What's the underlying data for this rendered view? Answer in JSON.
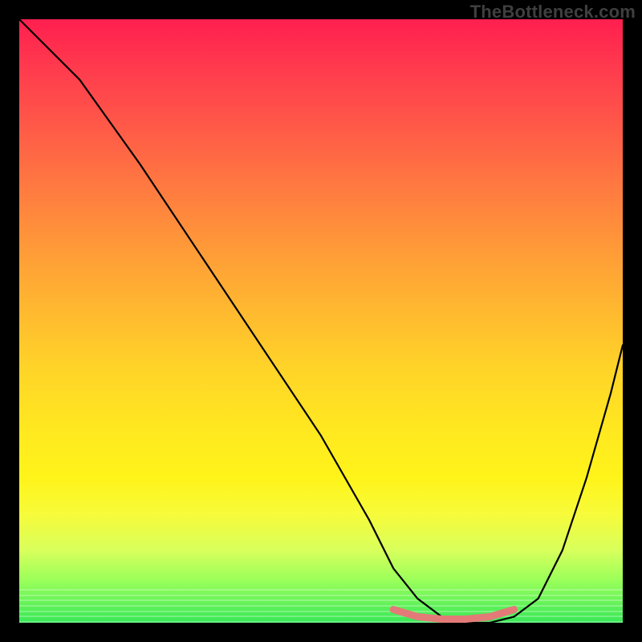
{
  "attribution": "TheBottleneck.com",
  "chart_data": {
    "type": "line",
    "title": "",
    "xlabel": "",
    "ylabel": "",
    "xlim": [
      0,
      100
    ],
    "ylim": [
      0,
      100
    ],
    "series": [
      {
        "name": "bottleneck-curve",
        "x": [
          0,
          3,
          6,
          10,
          20,
          30,
          40,
          50,
          58,
          62,
          66,
          70,
          74,
          78,
          82,
          86,
          90,
          94,
          98,
          100
        ],
        "y": [
          100,
          97,
          94,
          90,
          76,
          61,
          46,
          31,
          17,
          9,
          4,
          1,
          0,
          0,
          1,
          4,
          12,
          24,
          38,
          46
        ]
      },
      {
        "name": "optimal-band",
        "x": [
          62,
          66,
          70,
          74,
          78,
          82
        ],
        "y": [
          2.2,
          1.0,
          0.6,
          0.6,
          1.0,
          2.2
        ]
      }
    ],
    "gradient_stops": [
      {
        "pos": 0,
        "color": "#ff1f4f"
      },
      {
        "pos": 50,
        "color": "#ffb830"
      },
      {
        "pos": 80,
        "color": "#fff41a"
      },
      {
        "pos": 100,
        "color": "#38e858"
      }
    ],
    "optimal_color": "#e47a78",
    "curve_color": "#000000"
  }
}
